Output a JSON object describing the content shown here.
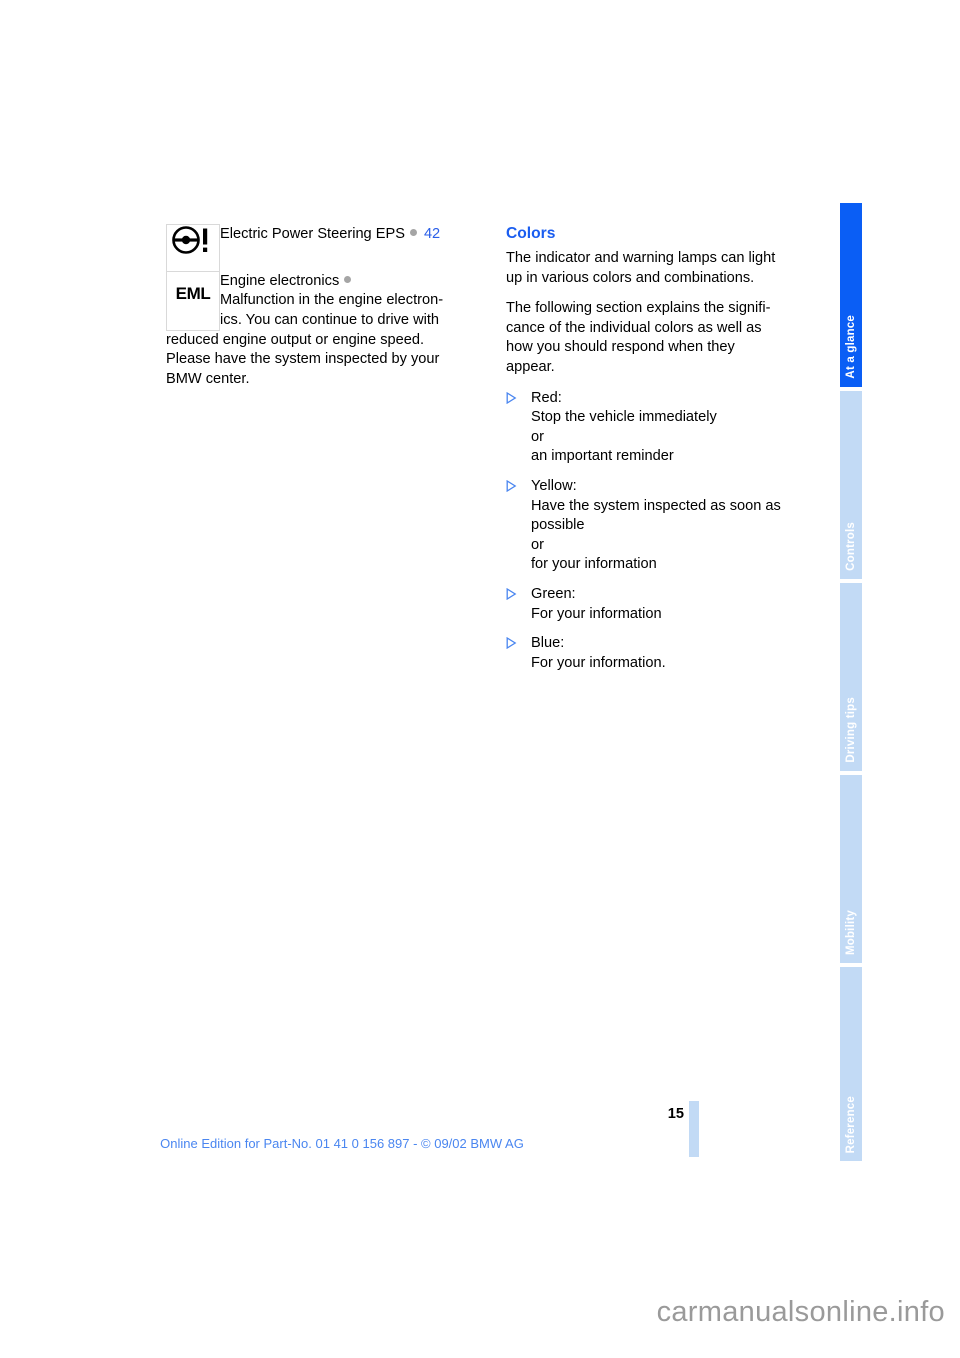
{
  "document": {
    "page_number": "15",
    "footer_note": "Online Edition for Part-No. 01 41 0 156 897 - © 09/02 BMW AG",
    "watermark": "carmanualsonline.info"
  },
  "colors": {
    "tab_active": "#0a5ef5",
    "tab_inactive": "#c2daf5",
    "heading_blue": "#1a5df0",
    "page_ref_blue": "#2a5fe8",
    "footer_blue": "#4a86f0",
    "bullet_dot_gray": "#a5a5a5",
    "watermark_gray": "#9a9a9a"
  },
  "tabs": [
    {
      "label": "At a glance",
      "active": true
    },
    {
      "label": "Controls",
      "active": false
    },
    {
      "label": "Driving tips",
      "active": false
    },
    {
      "label": "Mobility",
      "active": false
    },
    {
      "label": "Reference",
      "active": false
    }
  ],
  "left_column": {
    "lamp_rows": [
      {
        "icon": "steering-wheel-warning-icon",
        "name": "Electric Power Steering EPS",
        "page_ref": "42",
        "description": ""
      },
      {
        "icon": "eml-engine-electronics-icon",
        "icon_text": "EML",
        "name": "Engine electronics",
        "page_ref": "",
        "description": "Malfunction in the engine electron-\nics. You can continue to drive with"
      }
    ],
    "continuation": "reduced engine output or engine speed. Please have the system inspected by your BMW center."
  },
  "right_column": {
    "heading": "Colors",
    "paragraphs": [
      "The indicator and warning lamps can light up in various colors and combinations.",
      "The following section explains the signifi-cance of the individual colors as well as how you should respond when they appear."
    ],
    "bullets": [
      {
        "lines": [
          "Red:",
          "Stop the vehicle immediately",
          "or",
          "an important reminder"
        ]
      },
      {
        "lines": [
          "Yellow:",
          "Have the system inspected as soon as possible",
          "or",
          "for your information"
        ]
      },
      {
        "lines": [
          "Green:",
          "For your information"
        ]
      },
      {
        "lines": [
          "Blue:",
          "For your information."
        ]
      }
    ]
  }
}
